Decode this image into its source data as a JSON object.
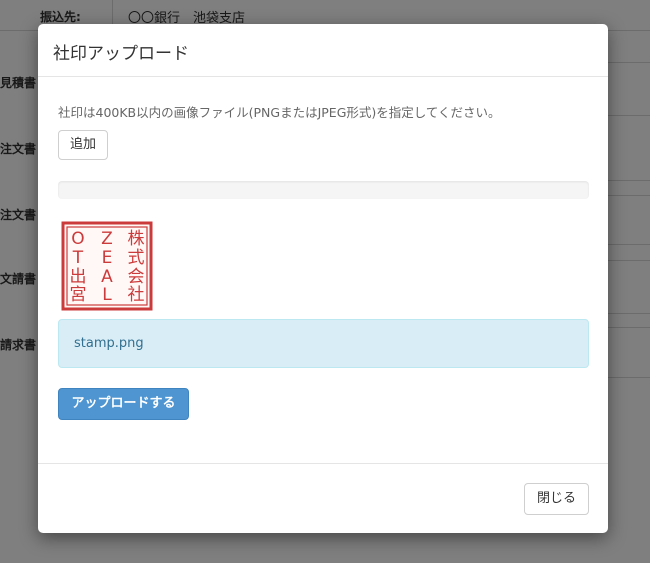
{
  "background": {
    "bank_label": "振込先:",
    "bank_value": "〇〇銀行　池袋支店",
    "left_labels": [
      "見積書",
      "注文書",
      "注文書",
      "文請書",
      "請求書"
    ]
  },
  "modal": {
    "title": "社印アップロード",
    "help_text": "社印は400KB以内の画像ファイル(PNGまたはJPEG形式)を指定してください。",
    "add_button": "追加",
    "progress": 0,
    "stamp": {
      "characters": [
        "株",
        "式",
        "会",
        "社",
        "Z",
        "E",
        "A",
        "L",
        "O",
        "T",
        "出",
        "宮"
      ],
      "color": "#cc3b3b"
    },
    "file_name": "stamp.png",
    "upload_button": "アップロードする",
    "close_button": "閉じる"
  },
  "colors": {
    "primary": "#4e95d2",
    "info_bg": "#d9edf7",
    "info_border": "#bce8f1",
    "info_text": "#31708f"
  }
}
